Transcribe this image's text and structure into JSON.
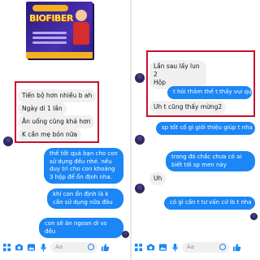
{
  "product": {
    "title": "BIOFIBER"
  },
  "left": {
    "incoming": [
      "Tiến bộ hơn nhiều b ah",
      "Ngày di 1 lần",
      "Ăn uống cũng khá hơn",
      "K cần mẹ bón nữa"
    ],
    "outgoing": [
      "thế tốt quá bạn cho con sử dụng đều nhé. nếu duy trì cho con khoảng 3 hộp để ổn định nha.",
      "khi con ổn định là k cần sử dụng nữa đâu",
      "con sẽ ăn ngoan di vs đều"
    ],
    "composer_placeholder": "Aa"
  },
  "right": {
    "incoming_top": [
      "Lần sau lấy lun 2",
      "Hộp"
    ],
    "outgoing_inline": "t hỏi thăm thế t thấy vui quá...",
    "incoming_bottom": "Uh t cũng thấy mừng2",
    "outgoing": [
      "sp tốt cố gì giới thiệu giúp t nha",
      "trong đó chắc chưa có ai biết tới sp men này"
    ],
    "incoming_short": "Uh",
    "outgoing_last": "có gì cần t tư vấn cứ ib t nha",
    "composer_placeholder": "Aa"
  },
  "icons": [
    "grid-icon",
    "camera-icon",
    "image-icon",
    "mic-icon",
    "emoji-icon",
    "like-icon"
  ],
  "colors": {
    "messenger_blue": "#1b86f5",
    "highlight_red": "#c8102e",
    "bubble_gray": "#f1f0f0"
  }
}
